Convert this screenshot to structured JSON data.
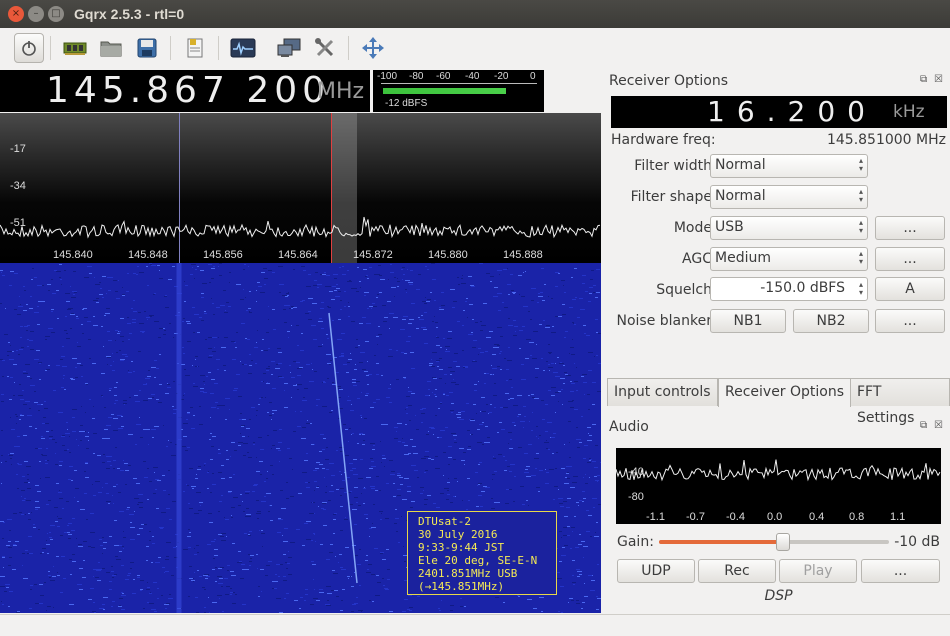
{
  "window": {
    "title": "Gqrx 2.5.3 - rtl=0",
    "close_glyph": "×",
    "min_glyph": "–",
    "max_glyph": "□"
  },
  "toolbar": {
    "icons": [
      "power-icon",
      "device-config-icon",
      "open-file-icon",
      "save-icon",
      "bookmarks-icon",
      "fft-plot-icon",
      "remote-control-icon",
      "tools-icon",
      "fullscreen-icon"
    ]
  },
  "frequency": {
    "value": "145.867 200",
    "unit": "MHz"
  },
  "smeter": {
    "ticks": [
      "-100",
      "-80",
      "-60",
      "-40",
      "-20",
      "0"
    ],
    "level_text": "-12 dBFS",
    "level_fraction": 0.82
  },
  "plot": {
    "db_labels": [
      "-17",
      "-34",
      "-51"
    ],
    "freq_labels": [
      "145.840",
      "145.848",
      "145.856",
      "145.864",
      "145.872",
      "145.880",
      "145.888"
    ]
  },
  "annotation": {
    "lines": [
      "DTUsat-2",
      "30 July 2016",
      "9:33-9:44 JST",
      "Ele 20 deg, SE-E-N",
      "2401.851MHz USB",
      "(→145.851MHz)"
    ]
  },
  "receiver": {
    "title": "Receiver Options",
    "bandwidth_value": "16.200",
    "bandwidth_unit": "kHz",
    "hw_freq_label": "Hardware freq:",
    "hw_freq_value": "145.851000 MHz",
    "filter_width_label": "Filter width",
    "filter_width_value": "Normal",
    "filter_shape_label": "Filter shape",
    "filter_shape_value": "Normal",
    "mode_label": "Mode",
    "mode_value": "USB",
    "agc_label": "AGC",
    "agc_value": "Medium",
    "squelch_label": "Squelch",
    "squelch_value": "-150.0 dBFS",
    "squelch_auto_button": "A",
    "noise_blanker_label": "Noise blanker",
    "nb1_button": "NB1",
    "nb2_button": "NB2",
    "more_button": "..."
  },
  "tabs": [
    "Input controls",
    "Receiver Options",
    "FFT Settings"
  ],
  "audio": {
    "title": "Audio",
    "y_labels": [
      "-40",
      "-80"
    ],
    "x_labels": [
      "-1.1",
      "-0.7",
      "-0.4",
      "0.0",
      "0.4",
      "0.8",
      "1.1"
    ],
    "gain_label": "Gain:",
    "gain_value": "-10 dB",
    "gain_fraction": 0.54,
    "udp_button": "UDP",
    "rec_button": "Rec",
    "play_button": "Play",
    "more_button": "...",
    "dsp_label": "DSP"
  }
}
